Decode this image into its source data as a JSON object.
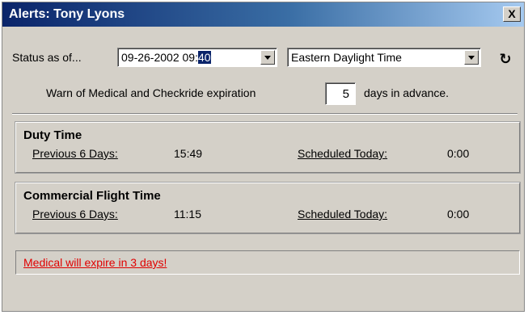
{
  "window": {
    "title": "Alerts: Tony Lyons",
    "close_glyph": "X"
  },
  "status": {
    "label": "Status as of...",
    "datetime_main": "09-26-2002 09:",
    "datetime_selected": "40",
    "timezone": "Eastern Daylight Time",
    "refresh_icon": "refresh-icon"
  },
  "warn": {
    "prefix": "Warn of Medical and Checkride expiration",
    "days": "5",
    "suffix": "days in advance."
  },
  "duty_time": {
    "title": "Duty Time",
    "prev_label": "Previous 6 Days:",
    "prev_value": "15:49",
    "sched_label": "Scheduled Today:",
    "sched_value": "0:00"
  },
  "commercial_flight_time": {
    "title": "Commercial Flight Time",
    "prev_label": "Previous 6 Days:",
    "prev_value": "11:15",
    "sched_label": "Scheduled Today:",
    "sched_value": "0:00"
  },
  "alerts": [
    {
      "text": "Medical will expire in 3 days!",
      "color": "#e00000"
    }
  ]
}
